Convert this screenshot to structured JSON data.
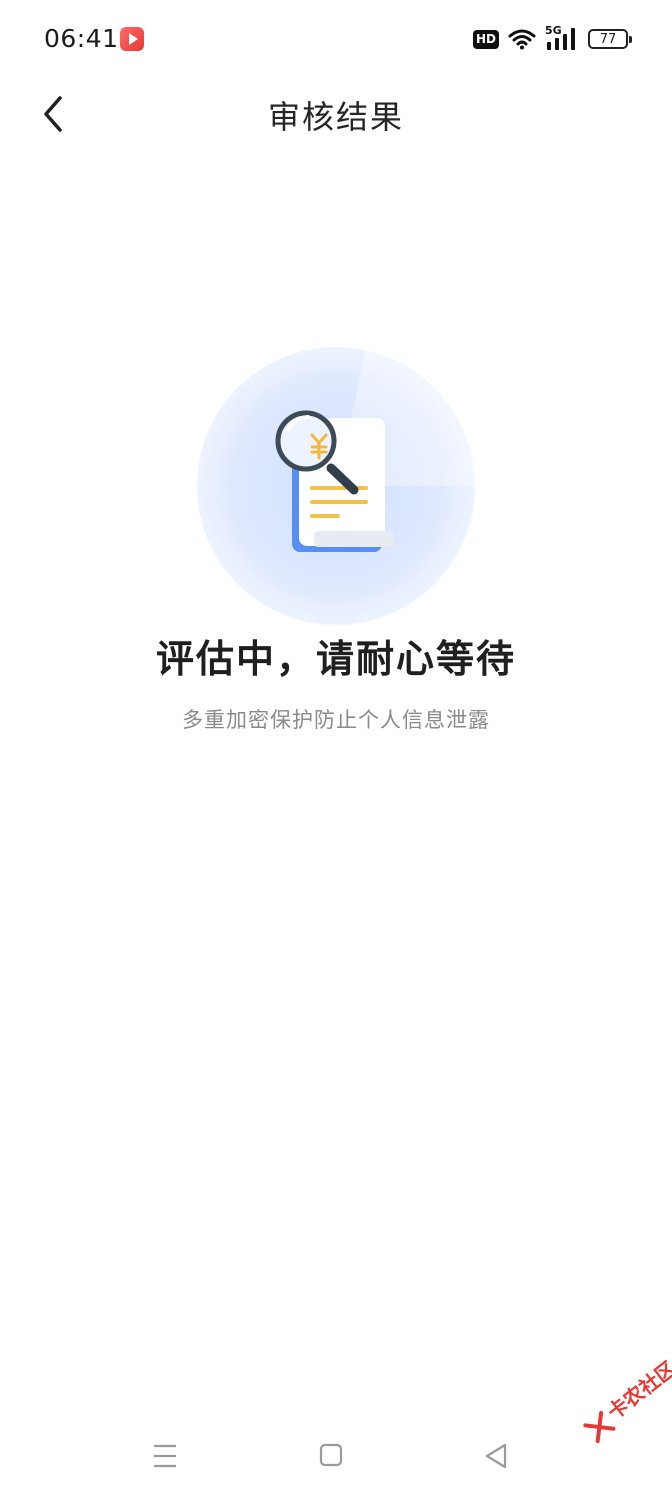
{
  "status_bar": {
    "time": "06:41",
    "hd_label": "HD",
    "network_label": "5G",
    "battery_level": "77"
  },
  "header": {
    "title": "审核结果",
    "back_icon": "chevron-left-icon"
  },
  "main": {
    "illustration_icon": "document-search-yuan-icon",
    "status_title": "评估中，请耐心等待",
    "status_subtitle": "多重加密保护防止个人信息泄露"
  },
  "system_nav": {
    "menu_icon": "menu-lines-icon",
    "home_icon": "square-home-icon",
    "back_icon": "triangle-back-icon"
  },
  "watermark": {
    "text": "卡农社区"
  },
  "colors": {
    "accent_blue": "#3f7ff0",
    "circle_light": "#e6eefc",
    "doc_lines": "#f3c14b"
  }
}
